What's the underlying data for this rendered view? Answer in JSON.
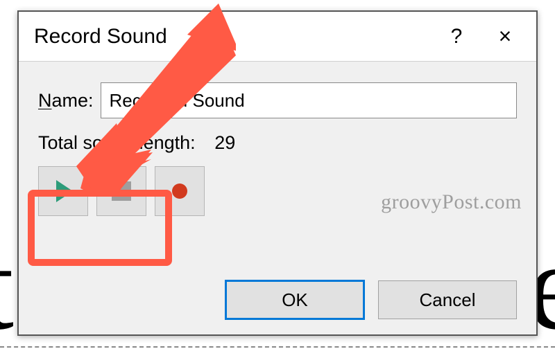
{
  "dialog": {
    "title": "Record Sound",
    "help": "?",
    "close": "×"
  },
  "name": {
    "label": "Name:",
    "value": "Recorded Sound"
  },
  "length": {
    "label": "Total sound length:",
    "value": "29"
  },
  "buttons": {
    "ok": "OK",
    "cancel": "Cancel"
  },
  "watermark": "groovyPost.com",
  "bg": {
    "left": "t",
    "right": "e"
  }
}
